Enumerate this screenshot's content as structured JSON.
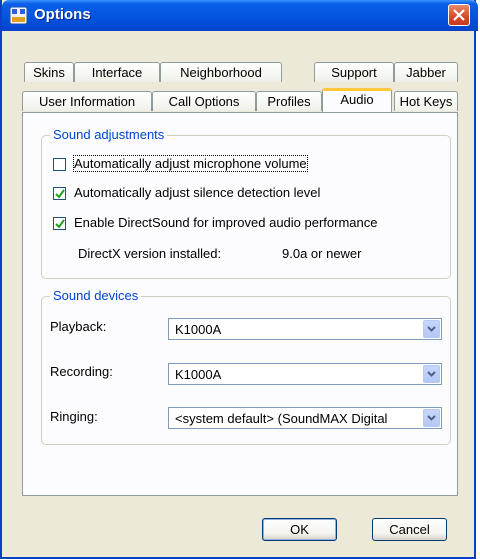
{
  "window": {
    "title": "Options"
  },
  "tabs_row1": [
    "Skins",
    "Interface",
    "Neighborhood",
    "Support",
    "Jabber"
  ],
  "tabs_row2": [
    "User Information",
    "Call Options",
    "Profiles",
    "Audio",
    "Hot Keys"
  ],
  "active_tab": "Audio",
  "sound_adjustments": {
    "legend": "Sound adjustments",
    "auto_mic": {
      "label": "Automatically adjust microphone volume",
      "checked": false
    },
    "auto_silence": {
      "label": "Automatically adjust silence detection level",
      "checked": true
    },
    "directsound": {
      "label": "Enable DirectSound for improved audio performance",
      "checked": true
    },
    "directx_label": "DirectX version installed:",
    "directx_value": "9.0a or newer"
  },
  "sound_devices": {
    "legend": "Sound devices",
    "playback": {
      "label": "Playback:",
      "value": "K1000A"
    },
    "recording": {
      "label": "Recording:",
      "value": "K1000A"
    },
    "ringing": {
      "label": "Ringing:",
      "value": "<system default> (SoundMAX Digital"
    }
  },
  "buttons": {
    "ok": "OK",
    "cancel": "Cancel"
  },
  "colors": {
    "titlebar": "#0555e0",
    "accent_tab": "#ffc83c",
    "group_label": "#0046d5"
  }
}
